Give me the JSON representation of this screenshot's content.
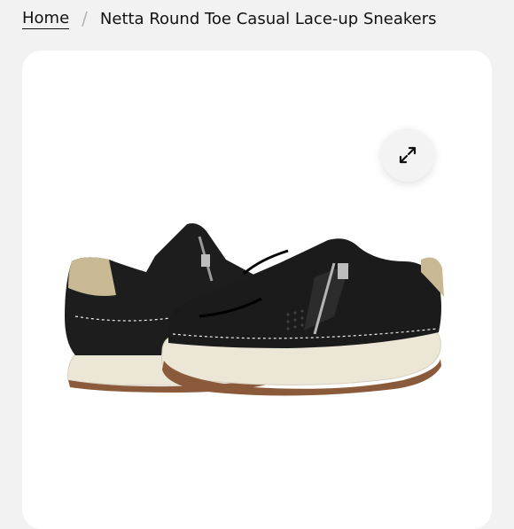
{
  "breadcrumb": {
    "home_label": "Home",
    "separator": "/",
    "current_label": "Netta Round Toe Casual Lace-up Sneakers"
  },
  "gallery": {
    "expand_icon": "expand-arrows-icon",
    "image_subject": "pair of black leather lace-up sneakers with side zipper"
  },
  "colors": {
    "page_bg": "#f2f2f2",
    "card_bg": "#ffffff",
    "shoe_leather": "#1c1c1c",
    "sole": "#ece6d6",
    "heel_accent": "#c9bb98"
  }
}
